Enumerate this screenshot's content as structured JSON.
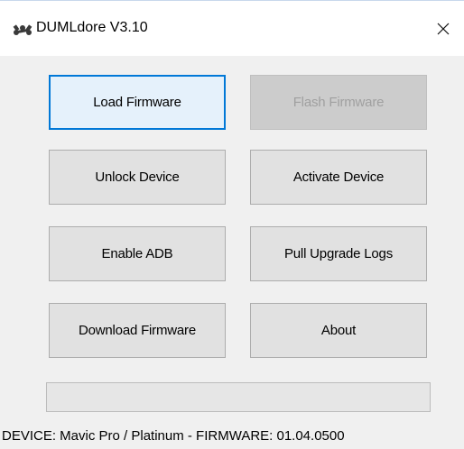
{
  "window": {
    "title": "DUMLdore V3.10",
    "app_icon": "drone-icon",
    "close_icon": "close-icon"
  },
  "buttons": {
    "load_firmware": "Load Firmware",
    "flash_firmware": "Flash Firmware",
    "unlock_device": "Unlock Device",
    "activate_device": "Activate Device",
    "enable_adb": "Enable ADB",
    "pull_upgrade_logs": "Pull Upgrade Logs",
    "download_firmware": "Download Firmware",
    "about": "About"
  },
  "button_states": {
    "flash_firmware_enabled": false,
    "load_firmware_focused": true
  },
  "progress": {
    "value": 0
  },
  "status": {
    "text": "DEVICE: Mavic Pro / Platinum - FIRMWARE: 01.04.0500"
  },
  "colors": {
    "focus_border": "#0078d7",
    "button_face": "#e1e1e1",
    "disabled_face": "#cccccc",
    "window_bg": "#f0f0f0",
    "progress_fill": "#06b025"
  }
}
